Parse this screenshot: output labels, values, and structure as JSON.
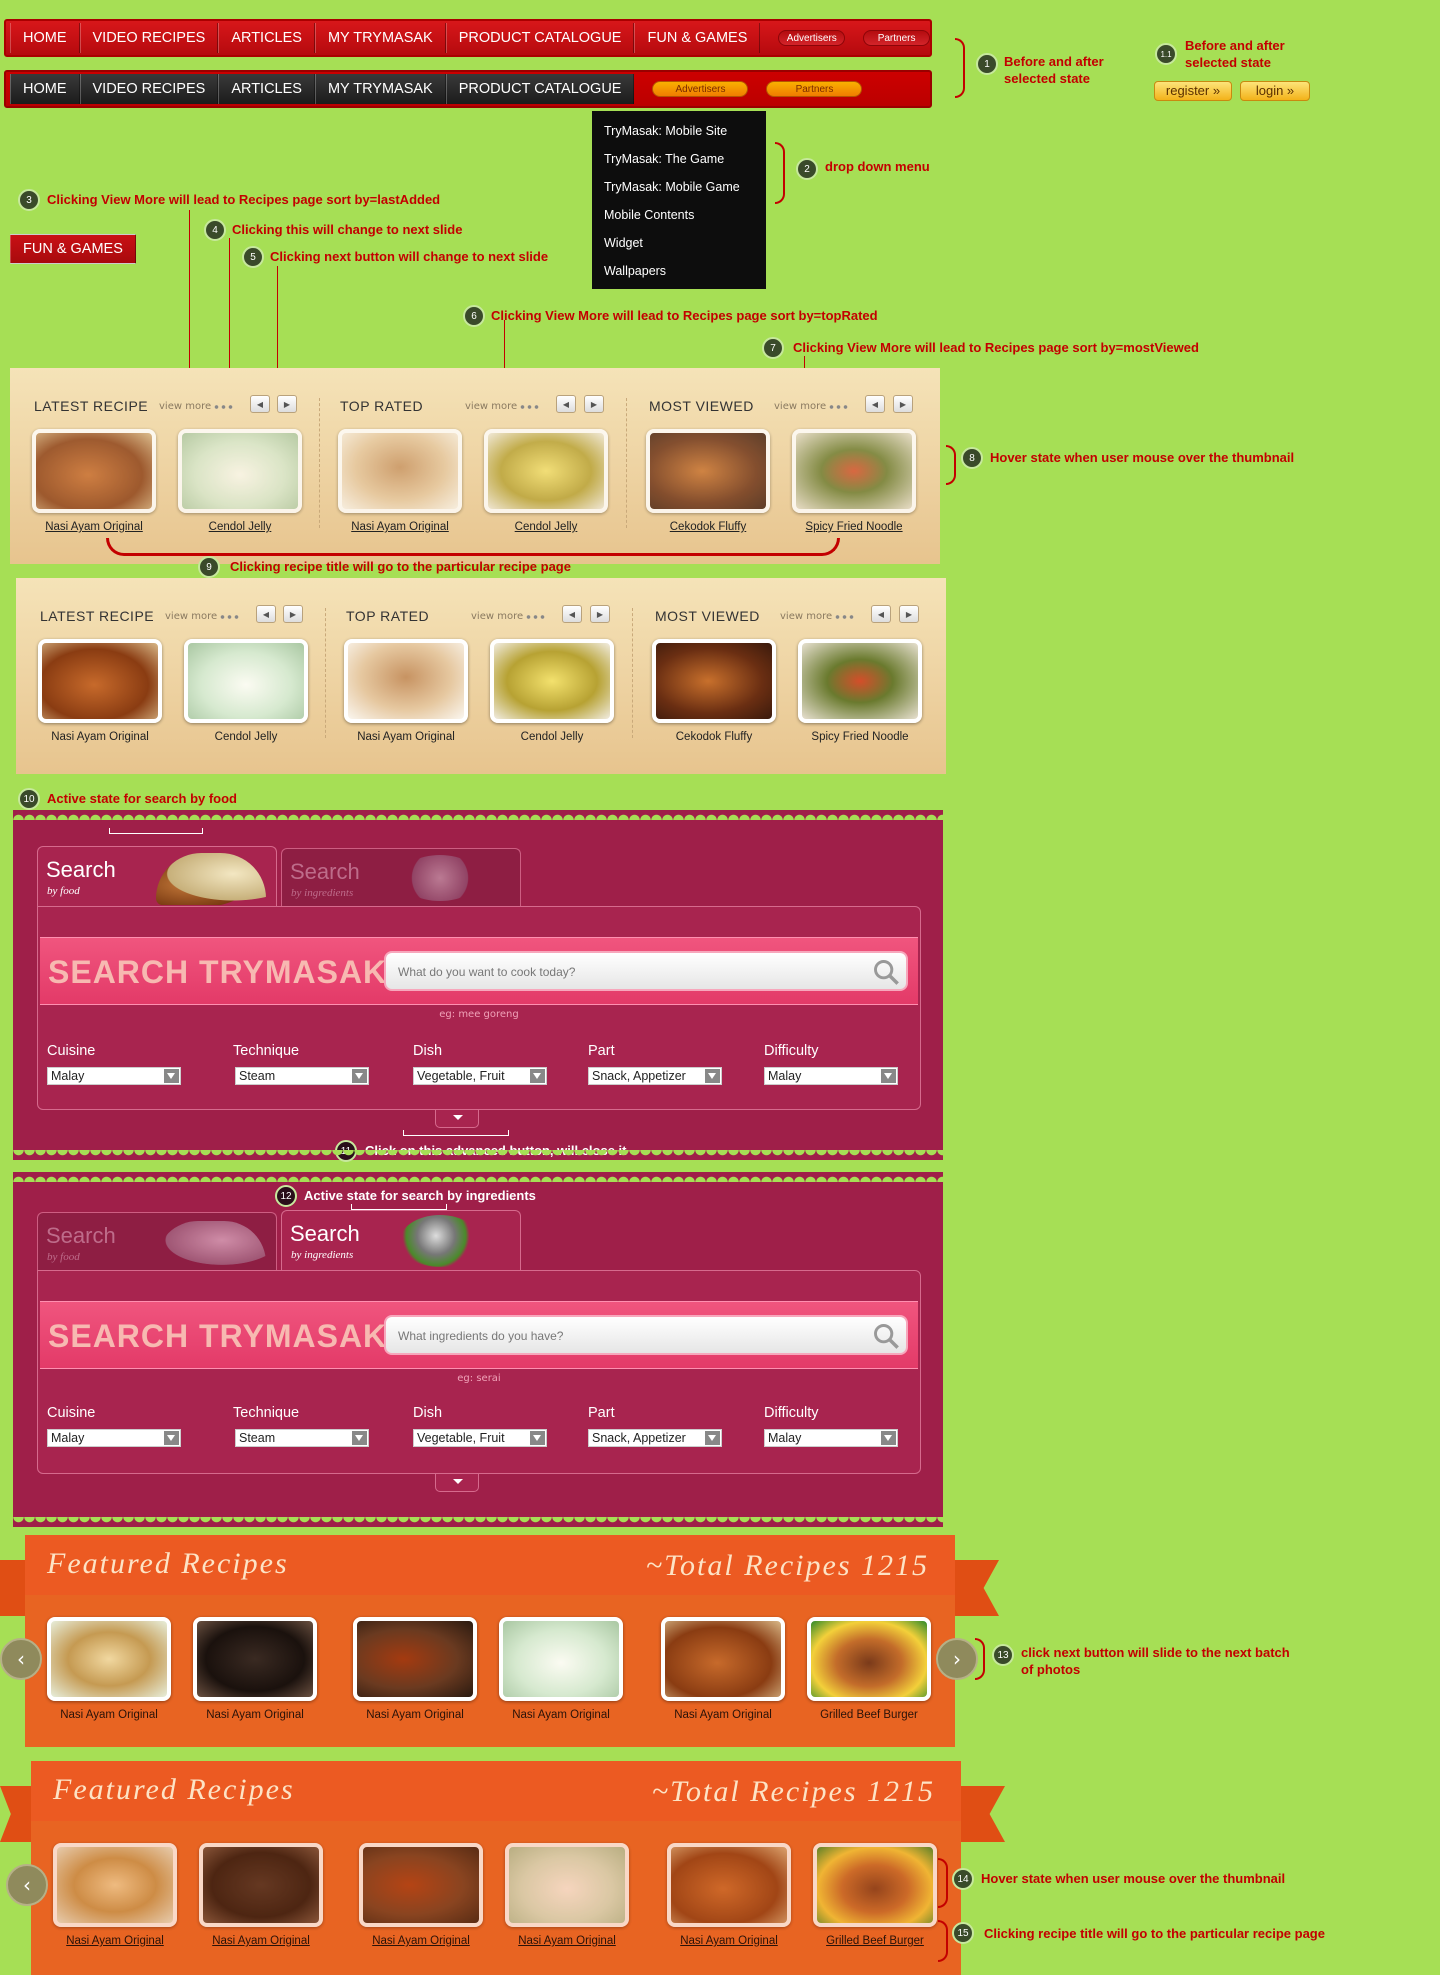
{
  "nav": {
    "items": [
      "HOME",
      "VIDEO RECIPES",
      "ARTICLES",
      "MY TRYMASAK",
      "PRODUCT CATALOGUE",
      "FUN & GAMES"
    ],
    "pills": [
      "Advertisers",
      "Partners"
    ]
  },
  "dropdown": [
    "TryMasak: Mobile Site",
    "TryMasak: The Game",
    "TryMasak: Mobile Game",
    "Mobile Contents",
    "Widget",
    "Wallpapers"
  ],
  "auth": {
    "register": "register »",
    "login": "login »"
  },
  "notes": {
    "n1": "Before and after selected state",
    "n11": "Before and after selected state",
    "n2": "drop down menu",
    "n3": "Clicking View More will lead to Recipes page sort by=lastAdded",
    "n4": "Clicking this will change to next slide",
    "n5": "Clicking next button will change to next slide",
    "n6": "Clicking View More will lead to Recipes page sort by=topRated",
    "n7": "Clicking View More will lead to Recipes page sort by=mostViewed",
    "n8": "Hover state when user mouse over the thumbnail",
    "n9": "Clicking recipe title will go to the particular recipe page",
    "n10": "Active state for search by food",
    "n11b": "Click on this advanced button, will close it",
    "n12": "Active state for search by ingredients",
    "n13": "click next button will slide to the next batch of photos",
    "n14": "Hover state when user mouse over the thumbnail",
    "n15": "Clicking recipe title will go to the particular recipe page"
  },
  "badges": [
    "1",
    "1.1",
    "2",
    "3",
    "4",
    "5",
    "6",
    "7",
    "8",
    "9",
    "10",
    "11",
    "12",
    "13",
    "14",
    "15"
  ],
  "recipes": {
    "sections": [
      "LATEST RECIPE",
      "TOP RATED",
      "MOST VIEWED"
    ],
    "view_more": "view more",
    "items": [
      "Nasi Ayam Original",
      "Cendol Jelly",
      "Nasi Ayam Original",
      "Cendol Jelly",
      "Cekodok Fluffy",
      "Spicy Fried Noodle"
    ]
  },
  "search": {
    "tab_title": "Search",
    "tab_food": "by food",
    "tab_ing": "by ingredients",
    "heading": "SEARCH TRYMASAK",
    "placeholder_food": "What do you want to cook today?",
    "placeholder_ing": "What ingredients do you have?",
    "eg_food": "eg: mee goreng",
    "eg_ing": "eg: serai",
    "filters": [
      {
        "label": "Cuisine",
        "value": "Malay"
      },
      {
        "label": "Technique",
        "value": "Steam"
      },
      {
        "label": "Dish",
        "value": "Vegetable, Fruit"
      },
      {
        "label": "Part",
        "value": "Snack, Appetizer"
      },
      {
        "label": "Difficulty",
        "value": "Malay"
      }
    ]
  },
  "featured": {
    "title": "Featured Recipes",
    "total": "~Total Recipes 1215",
    "items": [
      "Nasi Ayam Original",
      "Nasi Ayam Original",
      "Nasi Ayam Original",
      "Nasi Ayam Original",
      "Nasi Ayam Original",
      "Grilled Beef Burger"
    ]
  }
}
